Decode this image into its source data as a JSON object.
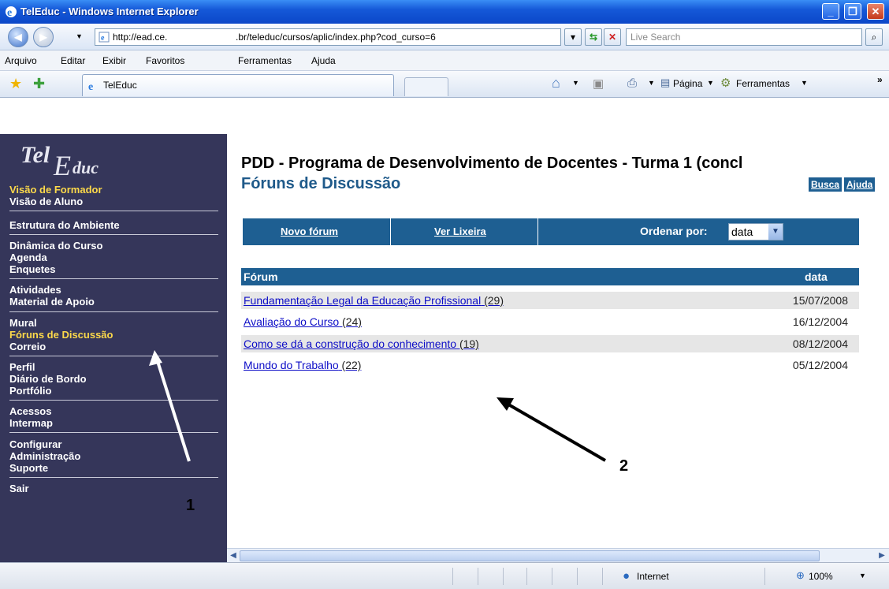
{
  "window": {
    "title": "TelEduc - Windows Internet Explorer",
    "min_label": "_",
    "max_label": "❐",
    "close_label": "✕"
  },
  "address": {
    "url_part1": "http://ead.ce.",
    "url_part2": ".br/teleduc/cursos/aplic/index.php?cod_curso=6",
    "search_placeholder": "Live Search"
  },
  "menu": {
    "items": [
      "Arquivo",
      "Editar",
      "Exibir",
      "Favoritos",
      "Ferramentas",
      "Ajuda"
    ]
  },
  "tabs": {
    "active_label": "TelEduc",
    "page_label": "Página",
    "tools_label": "Ferramentas"
  },
  "sidebar": {
    "logo_text": "TelEduc",
    "items": [
      "Visão de Formador",
      "Visão de Aluno",
      "Estrutura do Ambiente",
      "Dinâmica do Curso",
      "Agenda",
      "Enquetes",
      "Atividades",
      "Material de Apoio",
      "Mural",
      "Fóruns de Discussão",
      "Correio",
      "Perfil",
      "Diário de Bordo",
      "Portfólio",
      "Acessos",
      "Intermap",
      "Configurar",
      "Administração",
      "Suporte",
      "Sair"
    ],
    "highlight_color": "#fcd94a"
  },
  "main": {
    "page_title": "PDD - Programa de Desenvolvimento de Docentes - Turma 1 (concl",
    "section_title": "Fóruns de Discussão",
    "search_link": "Busca",
    "help_link": "Ajuda",
    "new_forum_link": "Novo fórum",
    "trash_link": "Ver Lixeira",
    "sort_label": "Ordenar por:",
    "sort_value": "data",
    "table": {
      "headers": [
        "Fórum",
        "data"
      ],
      "rows": [
        {
          "name": "Fundamentação Legal da Educação Profissional",
          "count": "(29)",
          "date": "15/07/2008"
        },
        {
          "name": "Avaliação do Curso",
          "count": "(24)",
          "date": "16/12/2004"
        },
        {
          "name": "Como se dá a construção do conhecimento",
          "count": "(19)",
          "date": "08/12/2004"
        },
        {
          "name": "Mundo do Trabalho",
          "count": "(22)",
          "date": "05/12/2004"
        }
      ]
    },
    "accent_color": "#1e5f92"
  },
  "status": {
    "zone": "Internet",
    "zoom": "100%"
  },
  "annotations": {
    "label1": "1",
    "label2": "2"
  }
}
